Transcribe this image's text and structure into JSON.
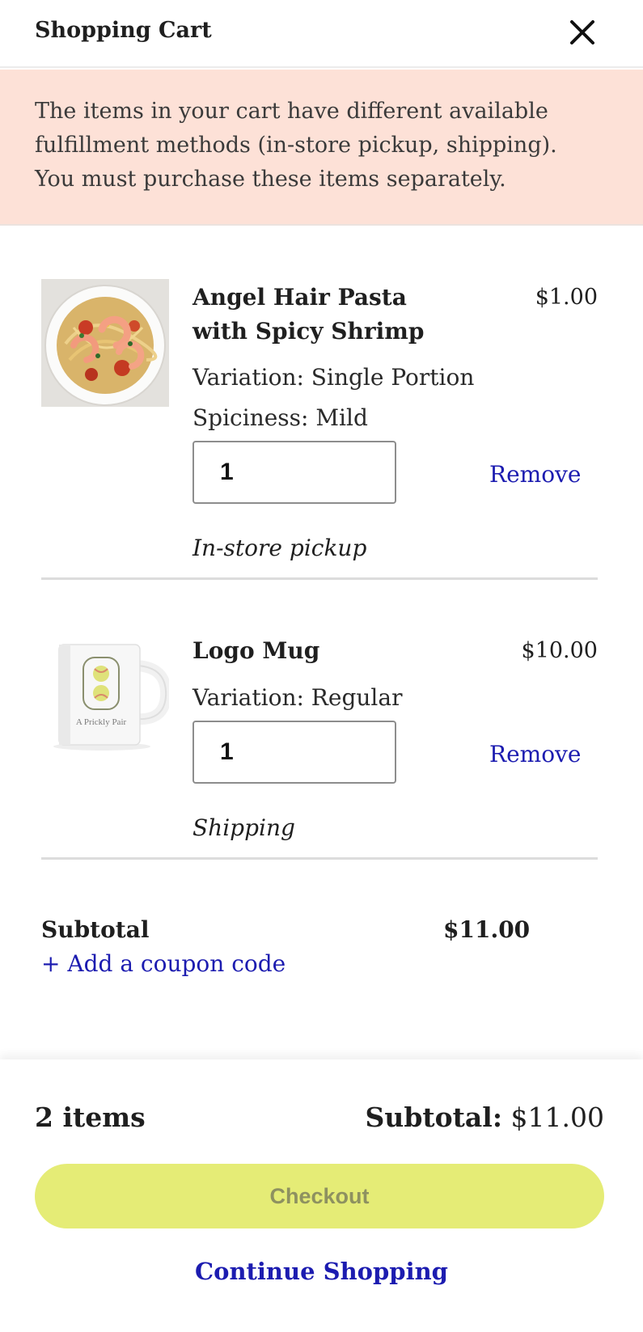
{
  "header": {
    "title": "Shopping Cart",
    "close_icon": "close-icon"
  },
  "banner": {
    "text": "The items in your cart have different available fulfillment methods (in-store pickup, shipping). You must purchase these items separately."
  },
  "items": [
    {
      "name_line1": "Angel Hair Pasta",
      "name_line2": "with Spicy Shrimp",
      "price": "$1.00",
      "variation": "Variation: Single Portion",
      "spiciness": "Spiciness: Mild",
      "quantity": "1",
      "remove_label": "Remove",
      "fulfillment": "In-store pickup"
    },
    {
      "name": "Logo Mug",
      "price": "$10.00",
      "variation": "Variation: Regular",
      "quantity": "1",
      "remove_label": "Remove",
      "fulfillment": "Shipping",
      "logo_text": "A Prickly Pair"
    }
  ],
  "summary": {
    "subtotal_label": "Subtotal",
    "subtotal_value": "$11.00",
    "coupon_link": "+ Add a coupon code"
  },
  "footer": {
    "item_count": "2 items",
    "subtotal_label": "Subtotal:",
    "subtotal_value": " $11.00",
    "checkout_label": "Checkout",
    "continue_label": "Continue Shopping"
  },
  "colors": {
    "banner_bg": "#fde1d7",
    "link": "#1c1cb0",
    "checkout_bg": "#e5ec76"
  }
}
